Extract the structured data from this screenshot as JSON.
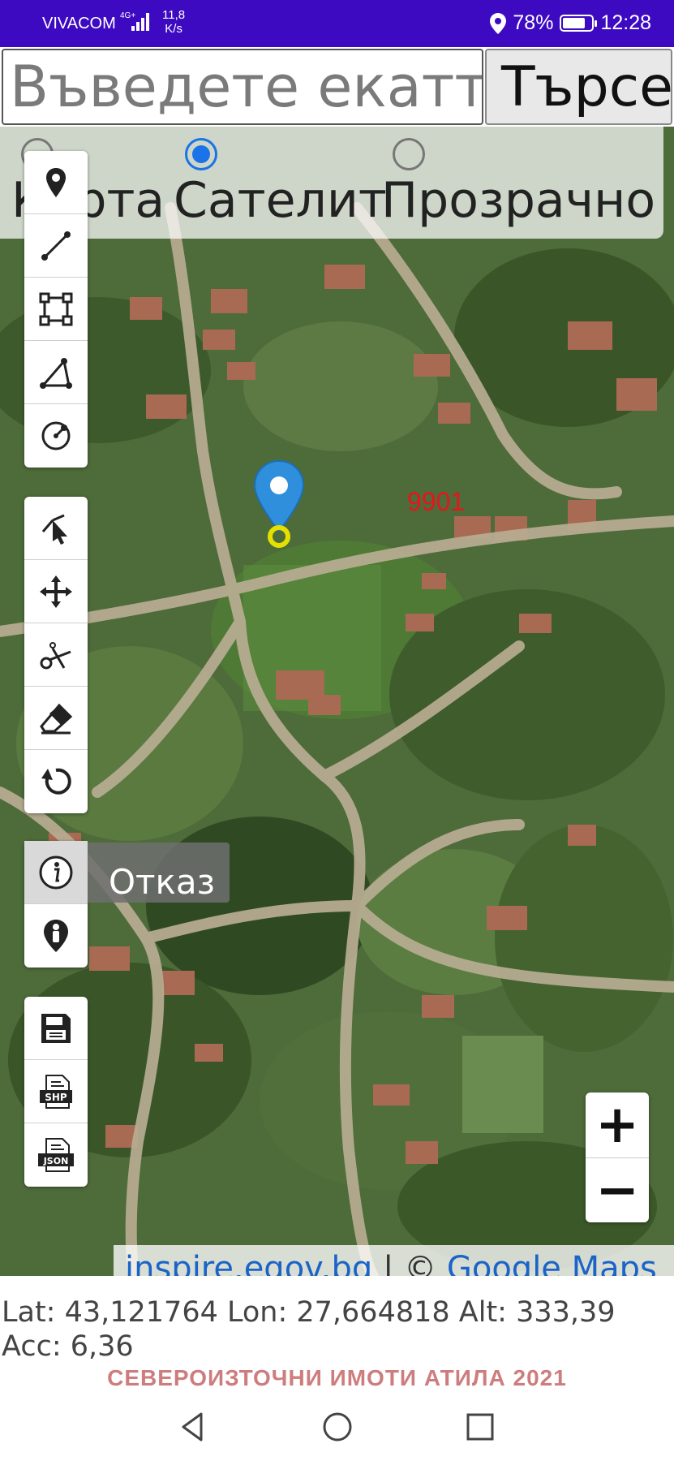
{
  "status_bar": {
    "carrier": "VIVACOM",
    "network": "4G+",
    "speed_value": "11,8",
    "speed_unit": "K/s",
    "battery_percent": "78%",
    "battery_level": 0.78,
    "time": "12:28"
  },
  "search": {
    "placeholder": "Въведете екатте",
    "button_label": "Търсене"
  },
  "layers": {
    "options": [
      {
        "label": "Карта",
        "checked": false
      },
      {
        "label": "Сателит",
        "checked": true
      },
      {
        "label": "Прозрачно",
        "checked": false
      }
    ]
  },
  "tools": {
    "draw_group": [
      "point-icon",
      "line-icon",
      "polygon-icon",
      "angle-icon",
      "circle-icon"
    ],
    "edit_group": [
      "select-icon",
      "move-icon",
      "cut-icon",
      "eraser-icon",
      "undo-icon"
    ],
    "info_group": [
      "info-icon",
      "locate-person-icon"
    ],
    "export_group": [
      "save-icon",
      "shp-export-icon",
      "json-export-icon"
    ],
    "shp_label": "SHP",
    "json_label": "JSON"
  },
  "cancel_label": "Отказ",
  "map": {
    "parcel_number": "9901",
    "marker_color": "#2f8fdc"
  },
  "zoom": {
    "in_label": "+",
    "out_label": "−"
  },
  "attribution": {
    "source": "inspire.egov.bg",
    "separator": " | © ",
    "provider": "Google Maps"
  },
  "coordinates": {
    "text": "Lat: 43,121764 Lon: 27,664818 Alt: 333,39 Acc: 6,36"
  },
  "footer_brand": "СЕВЕРОИЗТОЧНИ ИМОТИ АТИЛА 2021",
  "colors": {
    "status_bar": "#3d0ac2",
    "accent": "#1a73e8",
    "parcel_label": "#e8141a",
    "brand": "#cd7d7d"
  }
}
